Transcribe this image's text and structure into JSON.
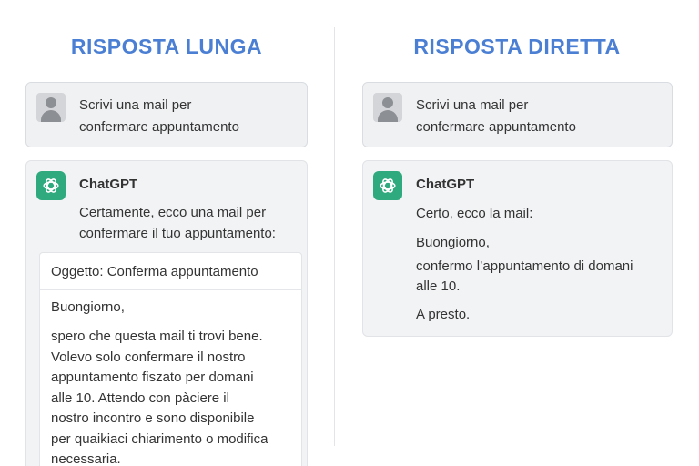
{
  "colors": {
    "title": "#4a7fd4",
    "gpt_logo": "#2fa97e"
  },
  "left": {
    "title": "RISPOSTA LUNGA",
    "prompt": {
      "line1": "Scrivi una mail per",
      "line2": "confermare appuntamento"
    },
    "reply": {
      "name": "ChatGPT",
      "intro1": "Certamente, ecco una mail per",
      "intro2": "confermare il tuo appuntamento:",
      "email": {
        "subject": "Oggetto: Conferma appuntamento",
        "greeting": "Buongiorno,",
        "body": [
          "spero che questa mail ti trovi bene.",
          "Volevo solo confermare il nostro",
          "appuntamento fiszato per domani",
          "alle 10. Attendo con pàciere il",
          "nostro incontro e sono disponibile",
          "per quaikiaci chiarimento o modifica",
          "necessaria."
        ]
      }
    }
  },
  "right": {
    "title": "RISPOSTA DIRETTA",
    "prompt": {
      "line1": "Scrivi una mail per",
      "line2": "confermare appuntamento"
    },
    "reply": {
      "name": "ChatGPT",
      "line1": "Certo, ecco la mail:",
      "line2": "Buongiorno,",
      "line3a": "confermo l’appuntamento di domani",
      "line3b": "alle 10.",
      "line4": "A presto."
    }
  }
}
